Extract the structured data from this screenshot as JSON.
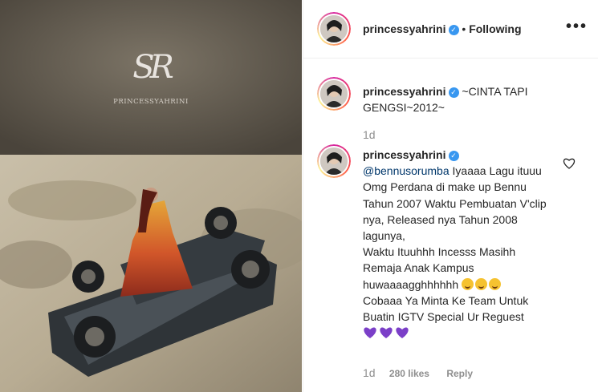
{
  "colors": {
    "accent": "#3897f0",
    "muted": "#8e8e8e",
    "mention": "#00376b",
    "purple_heart": "#7b3fc8"
  },
  "media": {
    "logo_monogram": "SR",
    "logo_name": "PRINCESSYAHRINI"
  },
  "header": {
    "username": "princessyahrini",
    "separator": "•",
    "follow_status": "Following",
    "more_icon": "more-options-icon"
  },
  "caption": {
    "username": "princessyahrini",
    "text": "~CINTA TAPI GENGSI~2012~",
    "time": "1d"
  },
  "comment": {
    "username": "princessyahrini",
    "mention": "@bennusorumba",
    "lines": [
      "Iyaaaa Lagu ituuu Omg Perdana di make up Bennu Tahun 2007 Waktu Pembuatan V'clip nya, Released nya Tahun 2008 lagunya,",
      "Waktu Ituuhhh Incesss Masihh Remaja Anak Kampus",
      "huwaaaagghhhhhh",
      "Cobaaa Ya Minta Ke Team Untuk Buatin IGTV Special Ur Reguest"
    ],
    "emoji_icon": "laughing-face-icon",
    "time": "1d",
    "likes": "280 likes",
    "reply": "Reply"
  }
}
